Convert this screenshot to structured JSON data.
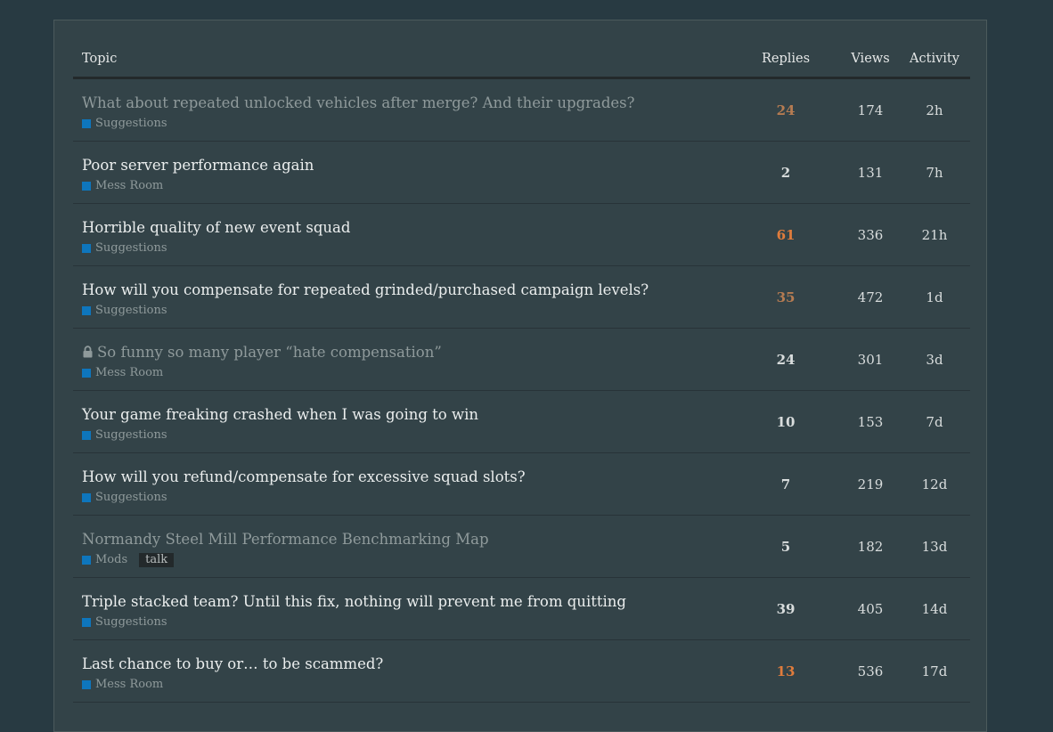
{
  "header": {
    "topic": "Topic",
    "replies": "Replies",
    "views": "Views",
    "activity": "Activity"
  },
  "colors": {
    "background": "#283a42",
    "panel": "#334348",
    "category": "#0e76bd",
    "heat_low": "#b67c52",
    "heat_high": "#e07c3c"
  },
  "topics": [
    {
      "title": "What about repeated unlocked vehicles after merge? And their upgrades?",
      "category": "Suggestions",
      "tag": "",
      "replies": "24",
      "views": "174",
      "activity": "2h",
      "visited": true,
      "locked": false,
      "heat": "low"
    },
    {
      "title": "Poor server performance again",
      "category": "Mess Room",
      "tag": "",
      "replies": "2",
      "views": "131",
      "activity": "7h",
      "visited": false,
      "locked": false,
      "heat": ""
    },
    {
      "title": "Horrible quality of new event squad",
      "category": "Suggestions",
      "tag": "",
      "replies": "61",
      "views": "336",
      "activity": "21h",
      "visited": false,
      "locked": false,
      "heat": "high"
    },
    {
      "title": "How will you compensate for repeated grinded/purchased campaign levels?",
      "category": "Suggestions",
      "tag": "",
      "replies": "35",
      "views": "472",
      "activity": "1d",
      "visited": false,
      "locked": false,
      "heat": "low"
    },
    {
      "title": "So funny so many player “hate compensation”",
      "category": "Mess Room",
      "tag": "",
      "replies": "24",
      "views": "301",
      "activity": "3d",
      "visited": true,
      "locked": true,
      "heat": "",
      "lock_icon": "lock-icon"
    },
    {
      "title": "Your game freaking crashed when I was going to win",
      "category": "Suggestions",
      "tag": "",
      "replies": "10",
      "views": "153",
      "activity": "7d",
      "visited": false,
      "locked": false,
      "heat": ""
    },
    {
      "title": "How will you refund/compensate for excessive squad slots?",
      "category": "Suggestions",
      "tag": "",
      "replies": "7",
      "views": "219",
      "activity": "12d",
      "visited": false,
      "locked": false,
      "heat": ""
    },
    {
      "title": "Normandy Steel Mill Performance Benchmarking Map",
      "category": "Mods",
      "tag": "talk",
      "replies": "5",
      "views": "182",
      "activity": "13d",
      "visited": true,
      "locked": false,
      "heat": ""
    },
    {
      "title": "Triple stacked team? Until this fix, nothing will prevent me from quitting",
      "category": "Suggestions",
      "tag": "",
      "replies": "39",
      "views": "405",
      "activity": "14d",
      "visited": false,
      "locked": false,
      "heat": ""
    },
    {
      "title": "Last chance to buy or… to be scammed?",
      "category": "Mess Room",
      "tag": "",
      "replies": "13",
      "views": "536",
      "activity": "17d",
      "visited": false,
      "locked": false,
      "heat": "high"
    }
  ]
}
